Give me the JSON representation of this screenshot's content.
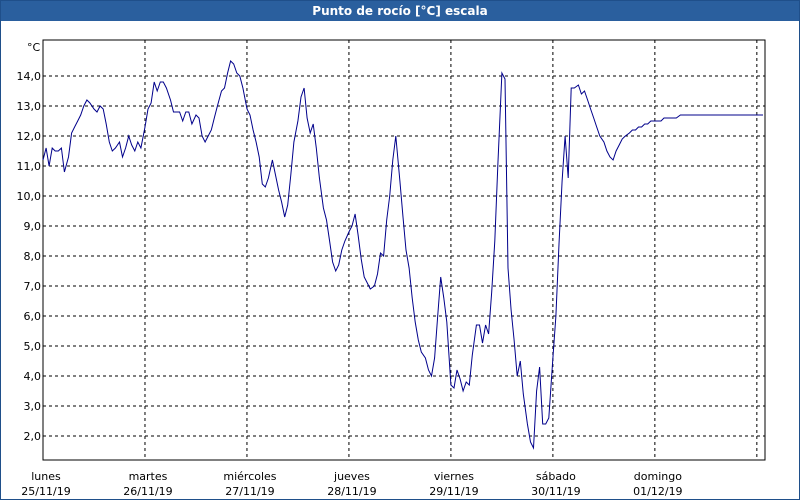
{
  "window": {
    "title": "Punto de rocío [°C] escala"
  },
  "chart_data": {
    "type": "line",
    "title": "Punto de rocío [°C] escala",
    "unit_label": "°C",
    "ylim": [
      1.2,
      15.2
    ],
    "y_ticks": [
      "14,0",
      "13,0",
      "12,0",
      "11,0",
      "10,0",
      "9,0",
      "8,0",
      "7,0",
      "6,0",
      "5,0",
      "4,0",
      "3,0",
      "2,0"
    ],
    "y_tick_values": [
      14,
      13,
      12,
      11,
      10,
      9,
      8,
      7,
      6,
      5,
      4,
      3,
      2
    ],
    "grid": true,
    "days": [
      {
        "name": "lunes",
        "date": "25/11/19"
      },
      {
        "name": "martes",
        "date": "26/11/19"
      },
      {
        "name": "miércoles",
        "date": "27/11/19"
      },
      {
        "name": "jueves",
        "date": "28/11/19"
      },
      {
        "name": "viernes",
        "date": "29/11/19"
      },
      {
        "name": "sábado",
        "date": "30/11/19"
      },
      {
        "name": "domingo",
        "date": "01/12/19"
      }
    ],
    "line_color": "#00008b",
    "series": [
      {
        "x": [
          0,
          0.03,
          0.06,
          0.09,
          0.12,
          0.15,
          0.18,
          0.21,
          0.25,
          0.28,
          0.31,
          0.34,
          0.37,
          0.4,
          0.43,
          0.46,
          0.5,
          0.53,
          0.56,
          0.59,
          0.62,
          0.65,
          0.68,
          0.71,
          0.75,
          0.78,
          0.81,
          0.84,
          0.87,
          0.9,
          0.93,
          0.96,
          1,
          1.03,
          1.06,
          1.09,
          1.12,
          1.15,
          1.18,
          1.21,
          1.25,
          1.28,
          1.31,
          1.34,
          1.37,
          1.4,
          1.43,
          1.46,
          1.5,
          1.53,
          1.56,
          1.59,
          1.62,
          1.65,
          1.68,
          1.71,
          1.75,
          1.78,
          1.81,
          1.84,
          1.87,
          1.9,
          1.93,
          1.96,
          2,
          2.03,
          2.06,
          2.09,
          2.12,
          2.15,
          2.18,
          2.21,
          2.25,
          2.28,
          2.31,
          2.34,
          2.37,
          2.4,
          2.43,
          2.46,
          2.5,
          2.53,
          2.56,
          2.59,
          2.62,
          2.65,
          2.68,
          2.71,
          2.75,
          2.78,
          2.81,
          2.84,
          2.87,
          2.9,
          2.93,
          2.96,
          3,
          3.03,
          3.06,
          3.09,
          3.12,
          3.15,
          3.18,
          3.21,
          3.25,
          3.28,
          3.31,
          3.34,
          3.37,
          3.4,
          3.43,
          3.46,
          3.5,
          3.53,
          3.56,
          3.59,
          3.62,
          3.65,
          3.68,
          3.71,
          3.75,
          3.78,
          3.81,
          3.84,
          3.87,
          3.9,
          3.93,
          3.96,
          4,
          4.03,
          4.06,
          4.09,
          4.12,
          4.15,
          4.18,
          4.21,
          4.25,
          4.28,
          4.31,
          4.34,
          4.37,
          4.4,
          4.43,
          4.46,
          4.5,
          4.53,
          4.56,
          4.59,
          4.62,
          4.65,
          4.68,
          4.71,
          4.75,
          4.78,
          4.81,
          4.84,
          4.87,
          4.9,
          4.93,
          4.96,
          5,
          5.03,
          5.06,
          5.09,
          5.12,
          5.15,
          5.18,
          5.21,
          5.25,
          5.28,
          5.31,
          5.34,
          5.37,
          5.4,
          5.43,
          5.46,
          5.5,
          5.53,
          5.56,
          5.59,
          5.62,
          5.65,
          5.68,
          5.71,
          5.75,
          5.78,
          5.81,
          5.84,
          5.87,
          5.9,
          5.93,
          5.96,
          6,
          6.03,
          6.06,
          6.09,
          6.12,
          6.15,
          6.18,
          6.21,
          6.25,
          6.28,
          6.31,
          6.34,
          6.37,
          6.4,
          6.43,
          6.46,
          6.5,
          6.53,
          6.56,
          6.59,
          6.62,
          6.65,
          6.68,
          6.71,
          6.75,
          6.78,
          6.81,
          6.84,
          6.87,
          6.9,
          6.93,
          6.96,
          7,
          7.03,
          7.06
        ],
        "y": [
          11.2,
          11.6,
          11.0,
          11.6,
          11.5,
          11.5,
          11.6,
          10.8,
          11.3,
          12.1,
          12.3,
          12.5,
          12.7,
          13.0,
          13.2,
          13.1,
          12.9,
          12.8,
          13.0,
          12.9,
          12.4,
          11.8,
          11.5,
          11.6,
          11.8,
          11.3,
          11.6,
          12.0,
          11.7,
          11.5,
          11.8,
          11.6,
          12.3,
          12.9,
          13.1,
          13.8,
          13.5,
          13.8,
          13.8,
          13.6,
          13.2,
          12.8,
          12.8,
          12.8,
          12.5,
          12.8,
          12.8,
          12.4,
          12.7,
          12.6,
          12.0,
          11.8,
          12.0,
          12.2,
          12.6,
          13.0,
          13.5,
          13.6,
          14.1,
          14.5,
          14.4,
          14.1,
          14.0,
          13.6,
          12.9,
          12.7,
          12.2,
          11.8,
          11.3,
          10.4,
          10.3,
          10.6,
          11.2,
          10.7,
          10.2,
          9.8,
          9.3,
          9.7,
          10.7,
          11.8,
          12.5,
          13.3,
          13.6,
          12.6,
          12.1,
          12.4,
          11.6,
          10.6,
          9.6,
          9.2,
          8.5,
          7.8,
          7.5,
          7.7,
          8.2,
          8.5,
          8.8,
          9.0,
          9.4,
          8.7,
          7.9,
          7.3,
          7.1,
          6.9,
          7.0,
          7.4,
          8.1,
          8.0,
          9.2,
          10.0,
          11.2,
          12.0,
          10.5,
          9.3,
          8.2,
          7.6,
          6.6,
          5.8,
          5.2,
          4.8,
          4.6,
          4.2,
          4.0,
          4.6,
          6.0,
          7.3,
          6.6,
          5.8,
          3.7,
          3.6,
          4.2,
          3.9,
          3.5,
          3.8,
          3.7,
          4.7,
          5.7,
          5.7,
          5.1,
          5.7,
          5.4,
          6.8,
          8.5,
          11.0,
          14.1,
          13.9,
          7.6,
          6.2,
          5.2,
          4.0,
          4.5,
          3.4,
          2.4,
          1.8,
          1.6,
          3.5,
          4.3,
          2.4,
          2.4,
          2.6,
          4.6,
          6.0,
          8.4,
          10.5,
          12.0,
          10.6,
          13.6,
          13.6,
          13.7,
          13.4,
          13.5,
          13.2,
          12.9,
          12.6,
          12.3,
          12.0,
          11.8,
          11.5,
          11.3,
          11.2,
          11.5,
          11.7,
          11.9,
          12.0,
          12.1,
          12.2,
          12.2,
          12.3,
          12.3,
          12.4,
          12.4,
          12.5,
          12.5,
          12.5,
          12.5,
          12.6,
          12.6,
          12.6,
          12.6,
          12.6,
          12.7,
          12.7,
          12.7,
          12.7,
          12.7,
          12.7,
          12.7,
          12.7,
          12.7,
          12.7,
          12.7,
          12.7,
          12.7,
          12.7,
          12.7,
          12.7,
          12.7,
          12.7,
          12.7,
          12.7,
          12.7,
          12.7,
          12.7,
          12.7,
          12.7,
          12.7,
          12.7
        ]
      }
    ]
  }
}
